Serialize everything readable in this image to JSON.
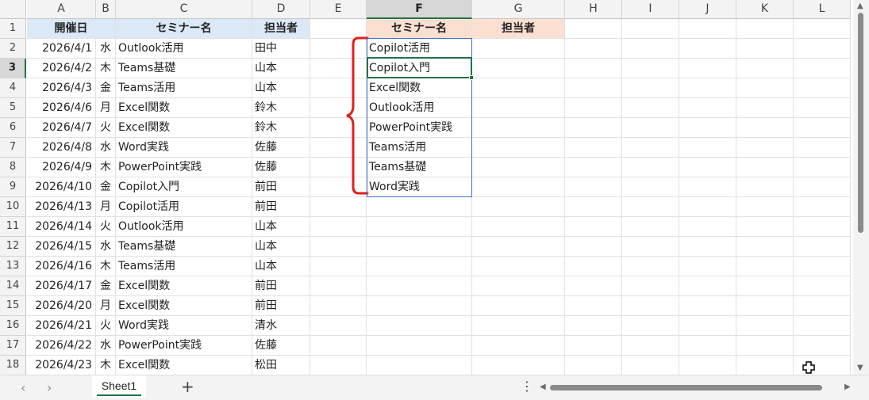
{
  "columns": [
    "A",
    "B",
    "C",
    "D",
    "E",
    "F",
    "G",
    "H",
    "I",
    "J",
    "K",
    "L"
  ],
  "selected_column": "F",
  "selected_row": 3,
  "rows": [
    1,
    2,
    3,
    4,
    5,
    6,
    7,
    8,
    9,
    10,
    11,
    12,
    13,
    14,
    15,
    16,
    17,
    18
  ],
  "table_headers": {
    "date": "開催日",
    "seminar": "セミナー名",
    "owner": "担当者"
  },
  "records": [
    {
      "date": "2026/4/1",
      "day": "水",
      "seminar": "Outlook活用",
      "owner": "田中"
    },
    {
      "date": "2026/4/2",
      "day": "木",
      "seminar": "Teams基礎",
      "owner": "山本"
    },
    {
      "date": "2026/4/3",
      "day": "金",
      "seminar": "Teams活用",
      "owner": "山本"
    },
    {
      "date": "2026/4/6",
      "day": "月",
      "seminar": "Excel関数",
      "owner": "鈴木"
    },
    {
      "date": "2026/4/7",
      "day": "火",
      "seminar": "Excel関数",
      "owner": "鈴木"
    },
    {
      "date": "2026/4/8",
      "day": "水",
      "seminar": "Word実践",
      "owner": "佐藤"
    },
    {
      "date": "2026/4/9",
      "day": "木",
      "seminar": "PowerPoint実践",
      "owner": "佐藤"
    },
    {
      "date": "2026/4/10",
      "day": "金",
      "seminar": "Copilot入門",
      "owner": "前田"
    },
    {
      "date": "2026/4/13",
      "day": "月",
      "seminar": "Copilot活用",
      "owner": "前田"
    },
    {
      "date": "2026/4/14",
      "day": "火",
      "seminar": "Outlook活用",
      "owner": "山本"
    },
    {
      "date": "2026/4/15",
      "day": "水",
      "seminar": "Teams基礎",
      "owner": "山本"
    },
    {
      "date": "2026/4/16",
      "day": "木",
      "seminar": "Teams活用",
      "owner": "山本"
    },
    {
      "date": "2026/4/17",
      "day": "金",
      "seminar": "Excel関数",
      "owner": "前田"
    },
    {
      "date": "2026/4/20",
      "day": "月",
      "seminar": "Excel関数",
      "owner": "前田"
    },
    {
      "date": "2026/4/21",
      "day": "火",
      "seminar": "Word実践",
      "owner": "清水"
    },
    {
      "date": "2026/4/22",
      "day": "水",
      "seminar": "PowerPoint実践",
      "owner": "佐藤"
    },
    {
      "date": "2026/4/23",
      "day": "木",
      "seminar": "Excel関数",
      "owner": "松田"
    }
  ],
  "unique_list": {
    "header_seminar": "セミナー名",
    "header_owner": "担当者",
    "items": [
      "Copilot活用",
      "Copilot入門",
      "Excel関数",
      "Outlook活用",
      "PowerPoint実践",
      "Teams活用",
      "Teams基礎",
      "Word実践"
    ]
  },
  "sheet_tab": {
    "label": "Sheet1"
  },
  "colors": {
    "header_blue": "#dbe8f6",
    "header_orange": "#fbe0d2",
    "selection_green": "#217346",
    "brace_red": "#e0201b",
    "list_border": "#4472c4"
  },
  "icons": {
    "prev_sheet": "chevron-left-icon",
    "next_sheet": "chevron-right-icon",
    "add_sheet": "plus-icon",
    "more": "vertical-dots-icon",
    "cursor": "cross-cursor-icon"
  }
}
